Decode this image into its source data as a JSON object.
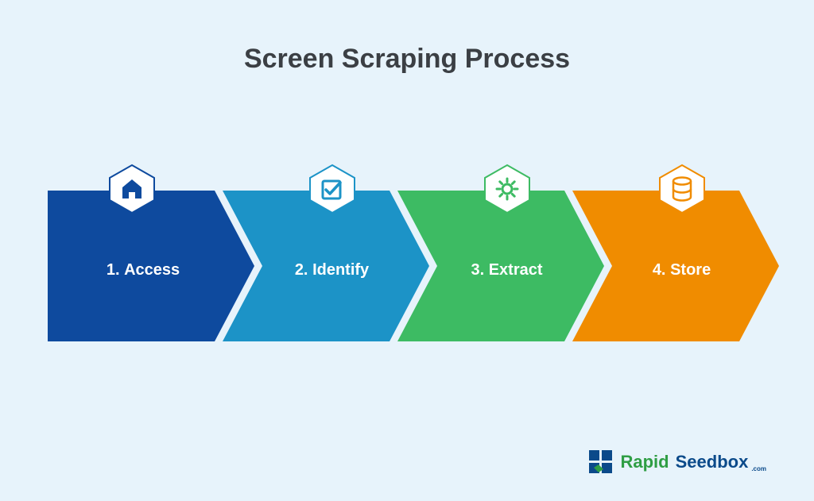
{
  "title": "Screen Scraping Process",
  "steps": [
    {
      "num": "1.",
      "label": "Access",
      "icon": "home-icon",
      "color": "#0e4a9e",
      "hexStroke": "#0e4a9e"
    },
    {
      "num": "2.",
      "label": "Identify",
      "icon": "checkbox-icon",
      "color": "#1c93c7",
      "hexStroke": "#1c93c7"
    },
    {
      "num": "3.",
      "label": "Extract",
      "icon": "gear-icon",
      "color": "#3dbb63",
      "hexStroke": "#3dbb63"
    },
    {
      "num": "4.",
      "label": "Store",
      "icon": "database-icon",
      "color": "#f08c00",
      "hexStroke": "#f08c00"
    }
  ],
  "logo": {
    "brand_a": "Rapid",
    "brand_b": "Seedbox",
    "suffix": ".com",
    "blue": "#0b4a8a",
    "green": "#2f9e44"
  }
}
